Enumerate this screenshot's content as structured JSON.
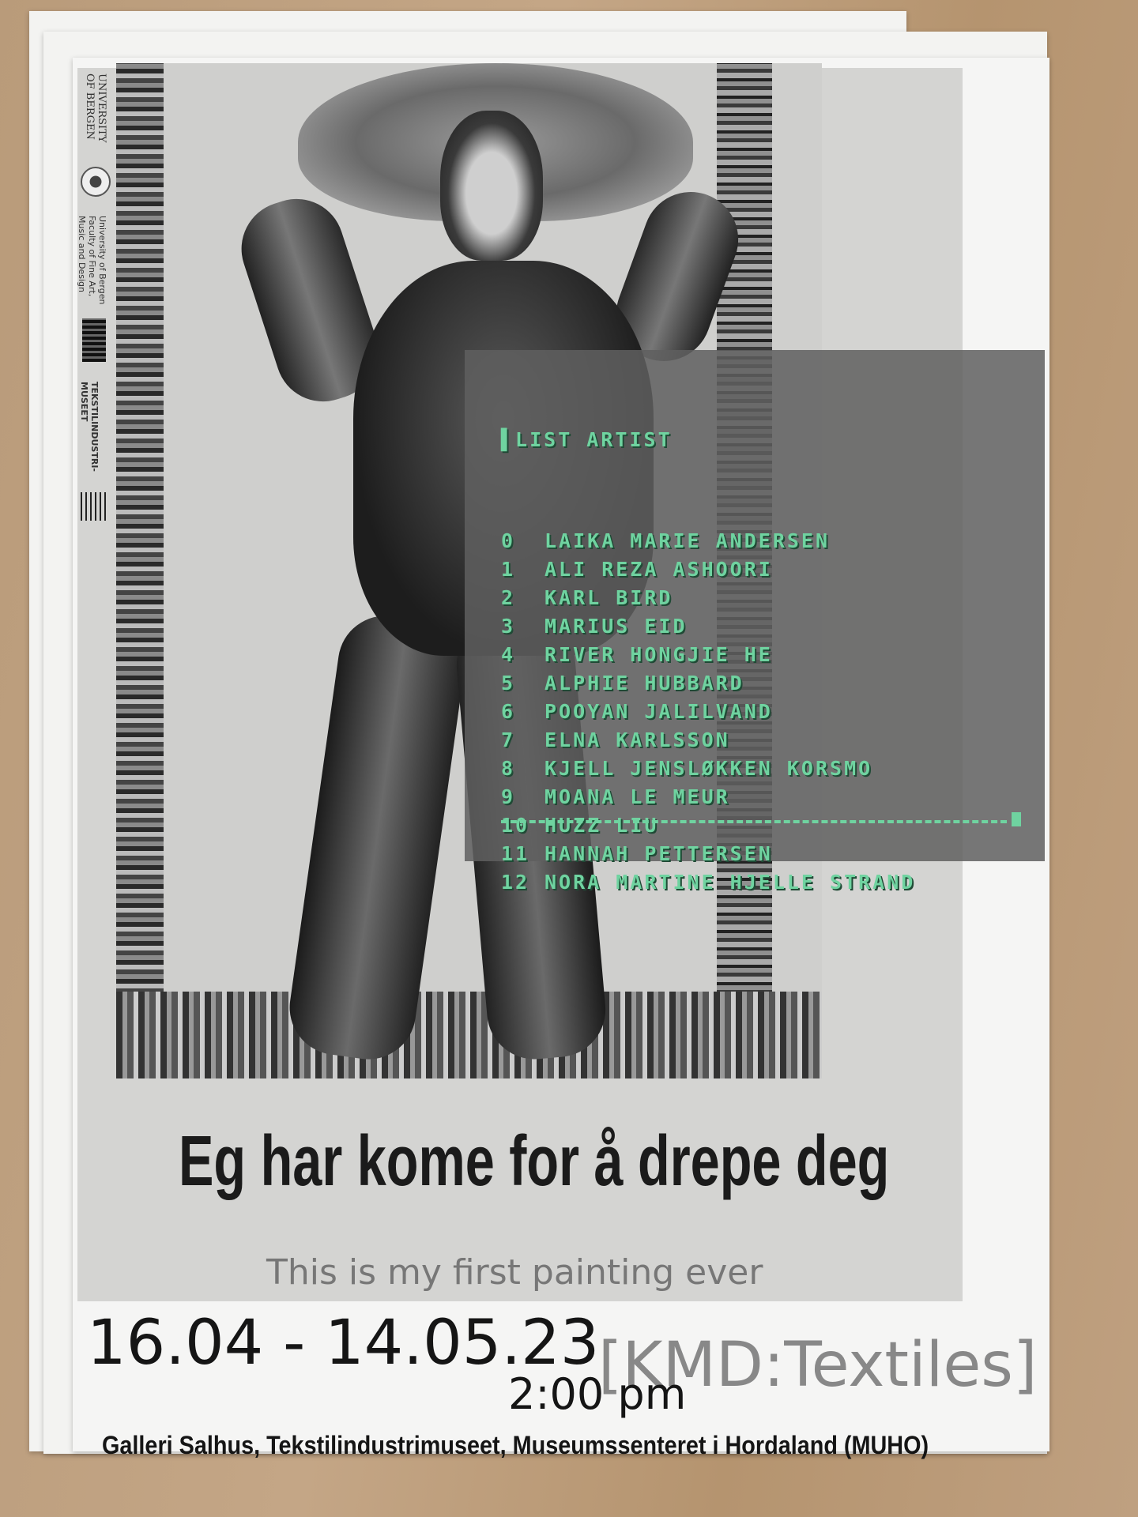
{
  "poster": {
    "side_strip": {
      "university": "UNIVERSITY OF BERGEN",
      "faculty": "University of Bergen Faculty of Fine Art, Music and Design",
      "museum": "TEKSTILINDUSTRI- MUSEET"
    },
    "terminal": {
      "header": "▌LIST ARTIST",
      "artists": [
        {
          "index": "0",
          "name": "LAIKA MARIE ANDERSEN"
        },
        {
          "index": "1",
          "name": "ALI REZA ASHOORI"
        },
        {
          "index": "2",
          "name": "KARL BIRD"
        },
        {
          "index": "3",
          "name": "MARIUS EID"
        },
        {
          "index": "4",
          "name": "RIVER HONGJIE HE"
        },
        {
          "index": "5",
          "name": "ALPHIE HUBBARD"
        },
        {
          "index": "6",
          "name": "POOYAN JALILVAND"
        },
        {
          "index": "7",
          "name": "ELNA KARLSSON"
        },
        {
          "index": "8",
          "name": "KJELL JENSLØKKEN KORSMO"
        },
        {
          "index": "9",
          "name": "MOANA LE MEUR"
        },
        {
          "index": "10",
          "name": "HUZZ LIU"
        },
        {
          "index": "11",
          "name": "HANNAH PETTERSEN"
        },
        {
          "index": "12",
          "name": "NORA MARTINE HJELLE STRAND"
        }
      ],
      "text_color": "#6fd3a0"
    },
    "title": "Eg har kome for å drepe deg",
    "subtitle": "This is my first painting ever",
    "dates": "16.04 - 14.05.23",
    "time": "2:00 pm",
    "tag": "[KMD:Textiles]",
    "venue": "Galleri Salhus, Tekstilindustrimuseet, Museumssenteret i Hordaland (MUHO)"
  }
}
